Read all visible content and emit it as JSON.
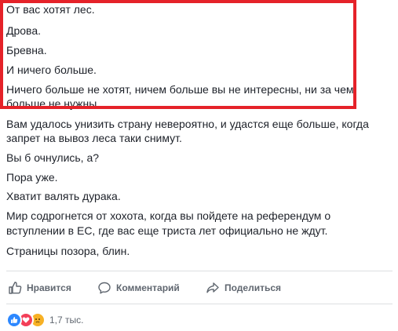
{
  "post": {
    "paragraphs": [
      "От вас хотят лес.",
      "Дрова.",
      "Бревна.",
      "И ничего больше.",
      "Ничего больше не хотят, ничем больше вы не интересны, ни за чем",
      "больше не нужны.",
      "Вам удалось унизить страну невероятно, и удастся еще больше, когда",
      "запрет на вывоз леса таки снимут.",
      "Вы б очнулись, а?",
      "Пора уже.",
      "Хватит валять дурака.",
      "Мир содрогнется от хохота, когда вы пойдете на референдум о",
      "вступлении в ЕС, где вас еще триста лет официально не ждут.",
      "Страницы позора, блин."
    ]
  },
  "actions": {
    "like_label": "Нравится",
    "comment_label": "Комментарий",
    "share_label": "Поделиться"
  },
  "reactions": {
    "icons": [
      "like-icon",
      "love-icon",
      "sad-icon"
    ],
    "count": "1,7 тыс."
  },
  "colors": {
    "highlight": "#e52229",
    "text": "#1d2129",
    "muted": "#606770",
    "like": "#2d88ff",
    "love": "#f33e58",
    "sad": "#f7b125"
  }
}
